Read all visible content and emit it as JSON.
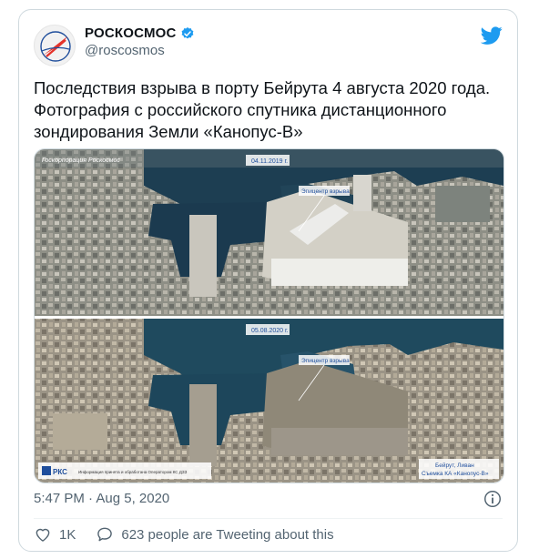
{
  "account": {
    "display_name": "РОСКОСМОС",
    "handle": "@roscosmos",
    "verified": true,
    "avatar_icon": "roscosmos-logo",
    "brand_color": "#e5332a"
  },
  "tweet": {
    "text_line1": "Последствия взрыва в порту Бейрута 4 августа 2020 года.",
    "text_line2": "Фотография с российского спутника дистанционного зондирования Земли «Канопус-В»"
  },
  "media": {
    "top_label": "Госкорпорация Роскосмос",
    "date_before": "04.11.2019 г.",
    "date_after": "05.08.2020 г.",
    "site_label_before": "Эпицентр взрыва",
    "site_label_after": "Эпицентр взрыва",
    "footer_logo": "РКС",
    "footer_left_text": "Информация принята и обработана Оператором КС ДЗЗ",
    "footer_right_line1": "Бейрут, Ливан",
    "footer_right_line2": "Съемка КА «Канопус-В»"
  },
  "meta": {
    "timestamp": "5:47 PM · Aug 5, 2020"
  },
  "actions": {
    "likes": "1K",
    "tweeting_text": "623 people are Tweeting about this"
  },
  "icons": {
    "bird": "twitter-bird-icon",
    "verified": "verified-badge-icon",
    "info": "info-icon",
    "heart": "heart-icon",
    "comment": "comment-icon"
  },
  "colors": {
    "twitter_blue": "#1d9bf0",
    "muted": "#536471"
  }
}
